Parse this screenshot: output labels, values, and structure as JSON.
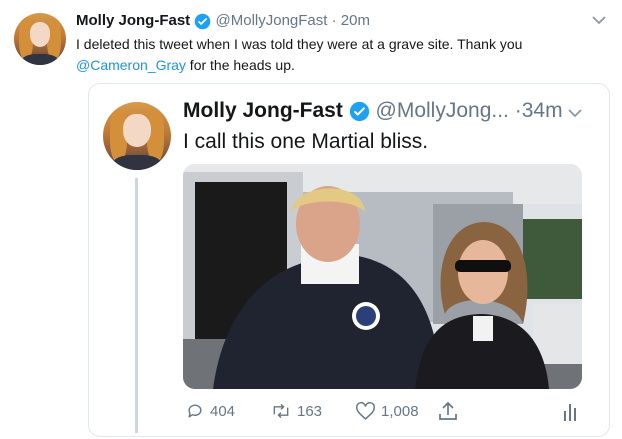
{
  "outer_tweet": {
    "author_name": "Molly Jong-Fast",
    "handle": "@MollyJongFast",
    "time": "· 20m",
    "text_before": "I deleted this tweet when I was told they were at a grave site. Thank you",
    "mention": "@Cameron_Gray",
    "text_after": " for the heads up."
  },
  "quoted_tweet": {
    "author_name": "Molly Jong-Fast",
    "handle": "@MollyJong...",
    "time": "·34m",
    "text": "I call this one Martial bliss."
  },
  "actions": {
    "replies": "404",
    "retweets": "163",
    "likes": "1,008"
  },
  "colors": {
    "verified": "#1da1f2",
    "link": "#1b95e0",
    "secondary": "#657786"
  }
}
